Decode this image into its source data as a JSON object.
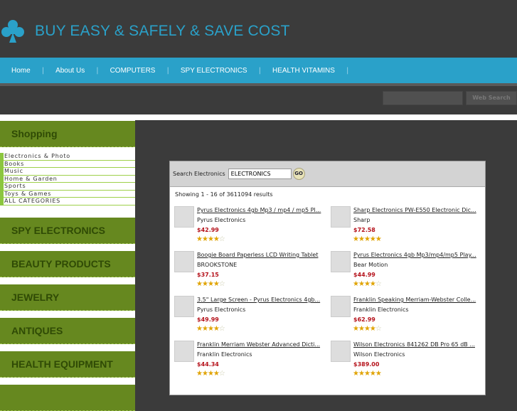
{
  "site": {
    "title": "BUY EASY & SAFELY & SAVE COST",
    "logo": "club-icon"
  },
  "nav": [
    "Home",
    "About Us",
    "COMPUTERS",
    "SPY ELECTRONICS",
    "HEALTH VITAMINS"
  ],
  "web_search": {
    "button": "Web Search",
    "value": ""
  },
  "sidebar": {
    "shopping": "Shopping",
    "categories": [
      "Electronics & Photo",
      "Books",
      "Music",
      "Home & Garden",
      "Sports",
      "Toys & Games",
      "ALL CATEGORIES"
    ],
    "boxes": [
      "SPY ELECTRONICS",
      "BEAUTY PRODUCTS",
      "JEWELRY",
      "ANTIQUES",
      "HEALTH EQUIPMENT"
    ]
  },
  "search": {
    "label": "Search Electronics",
    "value": "ELECTRONICS",
    "go": "GO"
  },
  "results": {
    "showing": "Showing 1 - 16 of 3611094 results",
    "items": [
      {
        "name": "Pyrus Electronics 4gb Mp3 / mp4 / mp5 Pl...",
        "brand": "Pyrus Electronics",
        "price": "$42.99",
        "rating": 3.5
      },
      {
        "name": "Sharp Electronics PW-E550 Electronic Dic...",
        "brand": "Sharp",
        "price": "$72.58",
        "rating": 4.5
      },
      {
        "name": "Boogie Board Paperless LCD Writing Tablet",
        "brand": "BROOKSTONE",
        "price": "$37.15",
        "rating": 3.5
      },
      {
        "name": "Pyrus Electronics 4gb Mp3/mp4/mp5 Play...",
        "brand": "Bear Motion",
        "price": "$44.99",
        "rating": 3.5
      },
      {
        "name": "3.5\" Large Screen - Pyrus Electronics 4gb...",
        "brand": "Pyrus Electronics",
        "price": "$49.99",
        "rating": 3.5
      },
      {
        "name": "Franklin Speaking Merriam-Webster Colle...",
        "brand": "Franklin Electronics",
        "price": "$62.99",
        "rating": 3.5
      },
      {
        "name": "Franklin Merriam Webster Advanced Dicti...",
        "brand": "Franklin Electronics",
        "price": "$44.34",
        "rating": 3.5
      },
      {
        "name": "Wilson Electronics 841262 DB Pro 65 dB ...",
        "brand": "Wilson Electronics",
        "price": "$389.00",
        "rating": 4.5
      }
    ]
  },
  "colors": {
    "accent": "#2aa1c9",
    "green": "#66881f",
    "price": "#b5121b"
  }
}
